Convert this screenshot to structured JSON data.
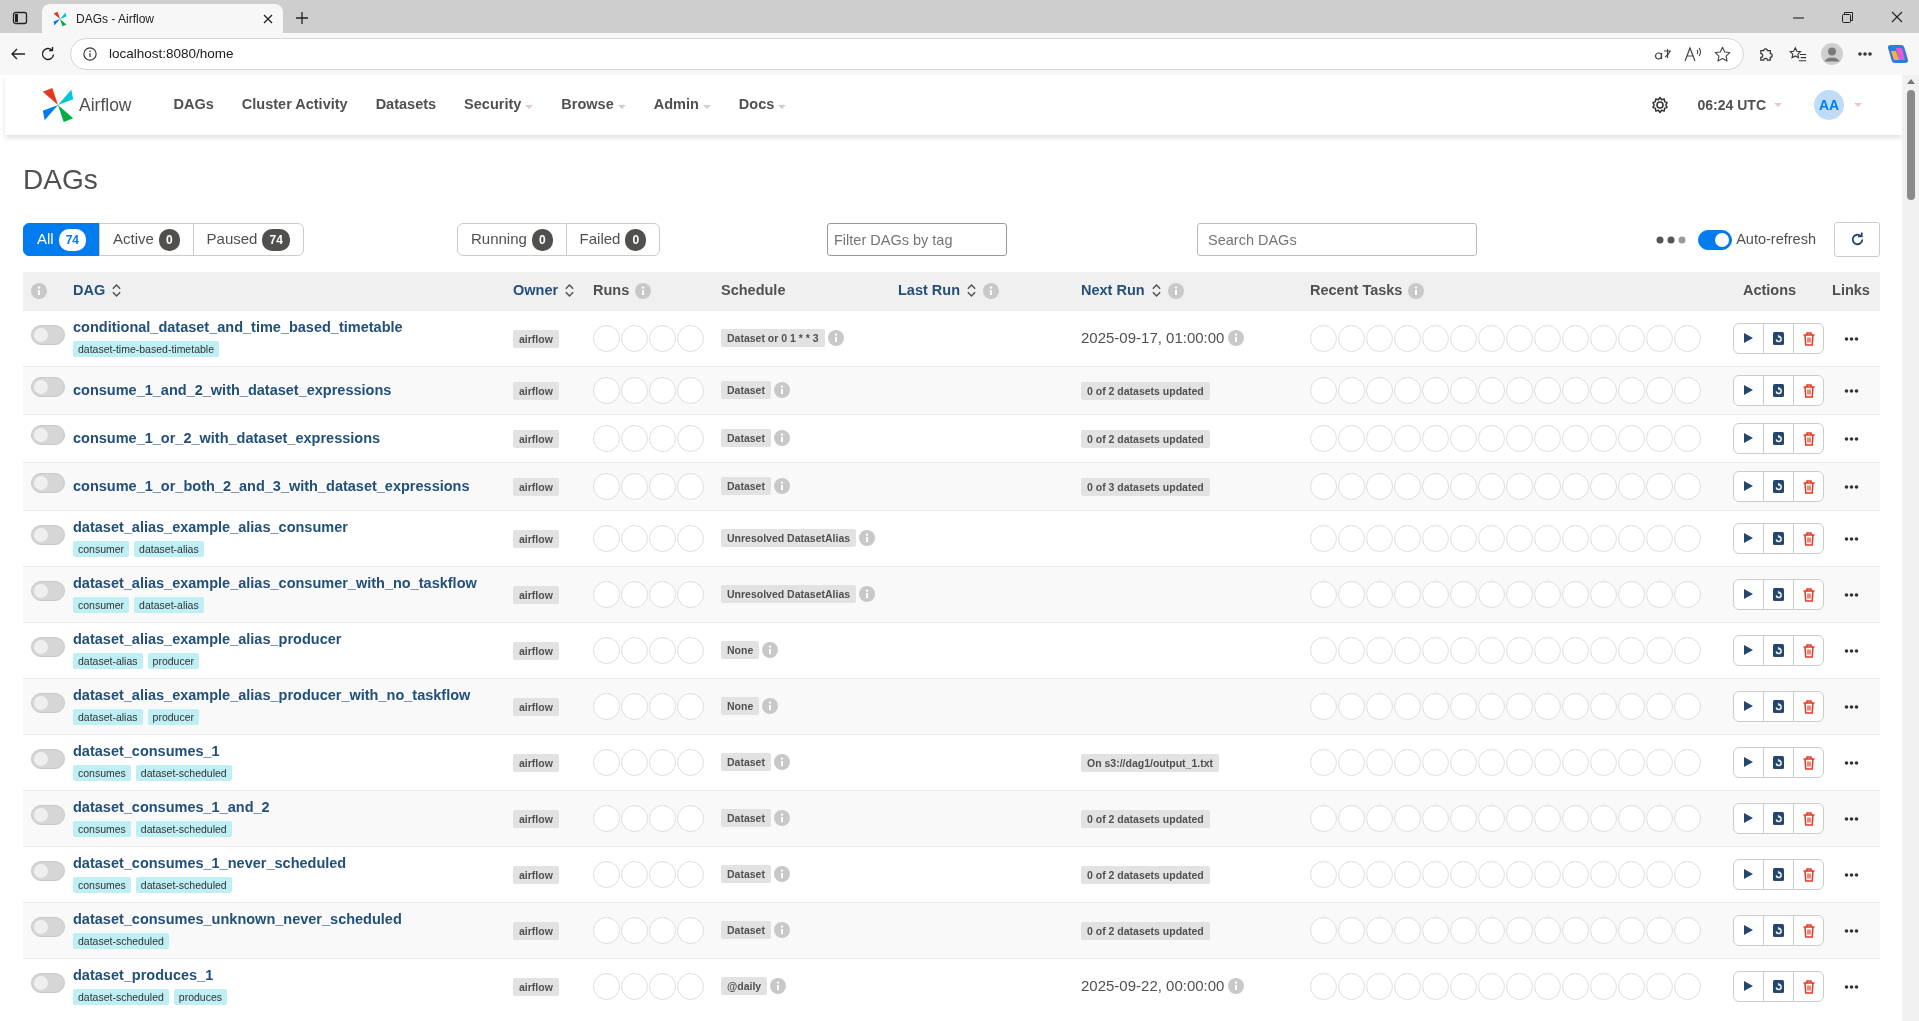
{
  "browser": {
    "tab_title": "DAGs - Airflow",
    "url": "localhost:8080/home"
  },
  "navbar": {
    "brand": "Airflow",
    "items": [
      {
        "label": "DAGs",
        "dropdown": false
      },
      {
        "label": "Cluster Activity",
        "dropdown": false
      },
      {
        "label": "Datasets",
        "dropdown": false
      },
      {
        "label": "Security",
        "dropdown": true
      },
      {
        "label": "Browse",
        "dropdown": true
      },
      {
        "label": "Admin",
        "dropdown": true
      },
      {
        "label": "Docs",
        "dropdown": true
      }
    ],
    "time": "06:24 UTC",
    "avatar": "AA"
  },
  "heading": "DAGs",
  "status_filters": [
    {
      "label": "All",
      "count": "74",
      "selected": true
    },
    {
      "label": "Active",
      "count": "0",
      "selected": false
    },
    {
      "label": "Paused",
      "count": "74",
      "selected": false
    }
  ],
  "run_filters": [
    {
      "label": "Running",
      "count": "0"
    },
    {
      "label": "Failed",
      "count": "0"
    }
  ],
  "tag_filter": {
    "placeholder": "Filter DAGs by tag"
  },
  "search": {
    "placeholder": "Search DAGs"
  },
  "auto_refresh": {
    "label": "Auto-refresh",
    "on": true
  },
  "table": {
    "columns": [
      {
        "info": true,
        "sortable": false
      },
      {
        "label": "DAG",
        "sortable": true,
        "info": false
      },
      {
        "label": "Owner",
        "sortable": true,
        "info": false
      },
      {
        "label": "Runs",
        "sortable": false,
        "info": true
      },
      {
        "label": "Schedule",
        "sortable": false,
        "info": false
      },
      {
        "label": "Last Run",
        "sortable": true,
        "info": true
      },
      {
        "label": "Next Run",
        "sortable": true,
        "info": true
      },
      {
        "label": "Recent Tasks",
        "sortable": false,
        "info": true
      },
      {
        "label": "Actions",
        "sortable": false,
        "info": false
      },
      {
        "label": "Links",
        "sortable": false,
        "info": false
      }
    ],
    "rows": [
      {
        "dag_id": "conditional_dataset_and_time_based_timetable",
        "active": false,
        "tags": [
          "dataset-time-based-timetable"
        ],
        "owner": "airflow",
        "schedule": "Dataset or 0 1 * * 3",
        "next_run": {
          "kind": "date",
          "text": "2025-09-17, 01:00:00"
        }
      },
      {
        "dag_id": "consume_1_and_2_with_dataset_expressions",
        "active": false,
        "tags": [],
        "owner": "airflow",
        "schedule": "Dataset",
        "next_run": {
          "kind": "badge",
          "text": "0 of 2 datasets updated"
        }
      },
      {
        "dag_id": "consume_1_or_2_with_dataset_expressions",
        "active": false,
        "tags": [],
        "owner": "airflow",
        "schedule": "Dataset",
        "next_run": {
          "kind": "badge",
          "text": "0 of 2 datasets updated"
        }
      },
      {
        "dag_id": "consume_1_or_both_2_and_3_with_dataset_expressions",
        "active": false,
        "tags": [],
        "owner": "airflow",
        "schedule": "Dataset",
        "next_run": {
          "kind": "badge",
          "text": "0 of 3 datasets updated"
        }
      },
      {
        "dag_id": "dataset_alias_example_alias_consumer",
        "active": false,
        "tags": [
          "consumer",
          "dataset-alias"
        ],
        "owner": "airflow",
        "schedule": "Unresolved DatasetAlias"
      },
      {
        "dag_id": "dataset_alias_example_alias_consumer_with_no_taskflow",
        "active": false,
        "tags": [
          "consumer",
          "dataset-alias"
        ],
        "owner": "airflow",
        "schedule": "Unresolved DatasetAlias"
      },
      {
        "dag_id": "dataset_alias_example_alias_producer",
        "active": false,
        "tags": [
          "dataset-alias",
          "producer"
        ],
        "owner": "airflow",
        "schedule": "None"
      },
      {
        "dag_id": "dataset_alias_example_alias_producer_with_no_taskflow",
        "active": false,
        "tags": [
          "dataset-alias",
          "producer"
        ],
        "owner": "airflow",
        "schedule": "None"
      },
      {
        "dag_id": "dataset_consumes_1",
        "active": false,
        "tags": [
          "consumes",
          "dataset-scheduled"
        ],
        "owner": "airflow",
        "schedule": "Dataset",
        "next_run": {
          "kind": "badge",
          "text": "On s3://dag1/output_1.txt"
        }
      },
      {
        "dag_id": "dataset_consumes_1_and_2",
        "active": false,
        "tags": [
          "consumes",
          "dataset-scheduled"
        ],
        "owner": "airflow",
        "schedule": "Dataset",
        "next_run": {
          "kind": "badge",
          "text": "0 of 2 datasets updated"
        }
      },
      {
        "dag_id": "dataset_consumes_1_never_scheduled",
        "active": false,
        "tags": [
          "consumes",
          "dataset-scheduled"
        ],
        "owner": "airflow",
        "schedule": "Dataset",
        "next_run": {
          "kind": "badge",
          "text": "0 of 2 datasets updated"
        }
      },
      {
        "dag_id": "dataset_consumes_unknown_never_scheduled",
        "active": false,
        "tags": [
          "dataset-scheduled"
        ],
        "owner": "airflow",
        "schedule": "Dataset",
        "next_run": {
          "kind": "badge",
          "text": "0 of 2 datasets updated"
        }
      },
      {
        "dag_id": "dataset_produces_1",
        "active": false,
        "tags": [
          "dataset-scheduled",
          "produces"
        ],
        "owner": "airflow",
        "schedule": "@daily",
        "next_run": {
          "kind": "date",
          "text": "2025-09-22, 00:00:00"
        }
      }
    ]
  }
}
